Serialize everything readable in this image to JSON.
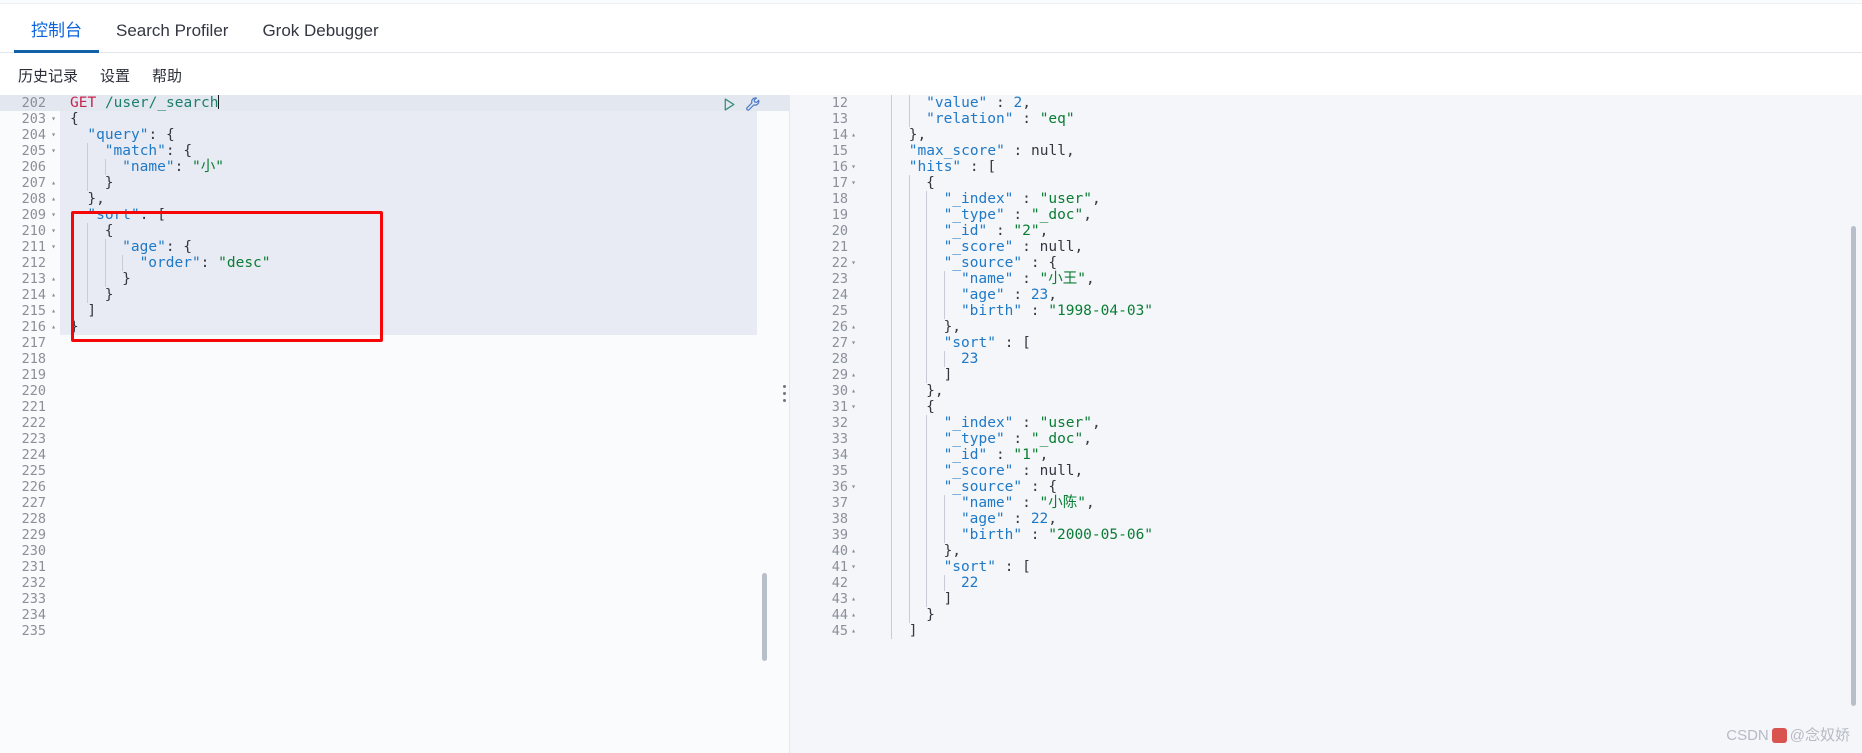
{
  "topbar": {
    "tabs": [
      {
        "label": "控制台",
        "active": true
      },
      {
        "label": "Search Profiler",
        "active": false
      },
      {
        "label": "Grok Debugger",
        "active": false
      }
    ]
  },
  "submenu": {
    "items": [
      {
        "label": "历史记录"
      },
      {
        "label": "设置"
      },
      {
        "label": "帮助"
      }
    ]
  },
  "colors": {
    "accent": "#0b64dd",
    "tab_underline": "#1361a8",
    "annotation_rect": "#f60606",
    "string": "#0a7d34",
    "key": "#2079c6",
    "method": "#c7254e",
    "url": "#1a7f6d",
    "active_line_bg": "#dfe3ed",
    "request_band_bg": "#e8ebf3"
  },
  "request_editor": {
    "name": "console-request-editor",
    "first_visible_line": 202,
    "active_line": 202,
    "icons": [
      {
        "name": "play-icon",
        "title": "click to send request"
      },
      {
        "name": "wrench-icon",
        "title": "open documentation"
      }
    ],
    "lines": [
      {
        "n": 202,
        "text": "GET /user/_search",
        "fold": "",
        "active": true
      },
      {
        "n": 203,
        "text": "{",
        "fold": "down"
      },
      {
        "n": 204,
        "text": "  \"query\": {",
        "fold": "down"
      },
      {
        "n": 205,
        "text": "    \"match\": {",
        "fold": "down"
      },
      {
        "n": 206,
        "text": "      \"name\": \"小\"",
        "fold": ""
      },
      {
        "n": 207,
        "text": "    }",
        "fold": "up"
      },
      {
        "n": 208,
        "text": "  },",
        "fold": "up"
      },
      {
        "n": 209,
        "text": "  \"sort\": [",
        "fold": "down"
      },
      {
        "n": 210,
        "text": "    {",
        "fold": "down"
      },
      {
        "n": 211,
        "text": "      \"age\": {",
        "fold": "down"
      },
      {
        "n": 212,
        "text": "        \"order\": \"desc\"",
        "fold": ""
      },
      {
        "n": 213,
        "text": "      }",
        "fold": "up"
      },
      {
        "n": 214,
        "text": "    }",
        "fold": "up"
      },
      {
        "n": 215,
        "text": "  ]",
        "fold": "up"
      },
      {
        "n": 216,
        "text": "}",
        "fold": "up"
      },
      {
        "n": 217,
        "text": "",
        "fold": ""
      },
      {
        "n": 218,
        "text": "",
        "fold": ""
      },
      {
        "n": 219,
        "text": "",
        "fold": ""
      },
      {
        "n": 220,
        "text": "",
        "fold": ""
      },
      {
        "n": 221,
        "text": "",
        "fold": ""
      },
      {
        "n": 222,
        "text": "",
        "fold": ""
      },
      {
        "n": 223,
        "text": "",
        "fold": ""
      },
      {
        "n": 224,
        "text": "",
        "fold": ""
      },
      {
        "n": 225,
        "text": "",
        "fold": ""
      },
      {
        "n": 226,
        "text": "",
        "fold": ""
      },
      {
        "n": 227,
        "text": "",
        "fold": ""
      },
      {
        "n": 228,
        "text": "",
        "fold": ""
      },
      {
        "n": 229,
        "text": "",
        "fold": ""
      },
      {
        "n": 230,
        "text": "",
        "fold": ""
      },
      {
        "n": 231,
        "text": "",
        "fold": ""
      },
      {
        "n": 232,
        "text": "",
        "fold": ""
      },
      {
        "n": 233,
        "text": "",
        "fold": ""
      },
      {
        "n": 234,
        "text": "",
        "fold": ""
      },
      {
        "n": 235,
        "text": "",
        "fold": ""
      }
    ],
    "annotation": {
      "name": "red-highlight-rectangle",
      "covers_lines": "209-216",
      "color": "#f60606"
    }
  },
  "response_editor": {
    "name": "console-response-editor",
    "first_visible_line": 12,
    "lines": [
      {
        "n": 12,
        "text": "      \"value\" : 2,",
        "fold": "",
        "clipped_top": true
      },
      {
        "n": 13,
        "text": "      \"relation\" : \"eq\"",
        "fold": ""
      },
      {
        "n": 14,
        "text": "    },",
        "fold": "up"
      },
      {
        "n": 15,
        "text": "    \"max_score\" : null,",
        "fold": ""
      },
      {
        "n": 16,
        "text": "    \"hits\" : [",
        "fold": "down"
      },
      {
        "n": 17,
        "text": "      {",
        "fold": "down"
      },
      {
        "n": 18,
        "text": "        \"_index\" : \"user\",",
        "fold": ""
      },
      {
        "n": 19,
        "text": "        \"_type\" : \"_doc\",",
        "fold": ""
      },
      {
        "n": 20,
        "text": "        \"_id\" : \"2\",",
        "fold": ""
      },
      {
        "n": 21,
        "text": "        \"_score\" : null,",
        "fold": ""
      },
      {
        "n": 22,
        "text": "        \"_source\" : {",
        "fold": "down"
      },
      {
        "n": 23,
        "text": "          \"name\" : \"小王\",",
        "fold": ""
      },
      {
        "n": 24,
        "text": "          \"age\" : 23,",
        "fold": ""
      },
      {
        "n": 25,
        "text": "          \"birth\" : \"1998-04-03\"",
        "fold": ""
      },
      {
        "n": 26,
        "text": "        },",
        "fold": "up"
      },
      {
        "n": 27,
        "text": "        \"sort\" : [",
        "fold": "down"
      },
      {
        "n": 28,
        "text": "          23",
        "fold": ""
      },
      {
        "n": 29,
        "text": "        ]",
        "fold": "up"
      },
      {
        "n": 30,
        "text": "      },",
        "fold": "up"
      },
      {
        "n": 31,
        "text": "      {",
        "fold": "down"
      },
      {
        "n": 32,
        "text": "        \"_index\" : \"user\",",
        "fold": ""
      },
      {
        "n": 33,
        "text": "        \"_type\" : \"_doc\",",
        "fold": ""
      },
      {
        "n": 34,
        "text": "        \"_id\" : \"1\",",
        "fold": ""
      },
      {
        "n": 35,
        "text": "        \"_score\" : null,",
        "fold": ""
      },
      {
        "n": 36,
        "text": "        \"_source\" : {",
        "fold": "down"
      },
      {
        "n": 37,
        "text": "          \"name\" : \"小陈\",",
        "fold": ""
      },
      {
        "n": 38,
        "text": "          \"age\" : 22,",
        "fold": ""
      },
      {
        "n": 39,
        "text": "          \"birth\" : \"2000-05-06\"",
        "fold": ""
      },
      {
        "n": 40,
        "text": "        },",
        "fold": "up"
      },
      {
        "n": 41,
        "text": "        \"sort\" : [",
        "fold": "down"
      },
      {
        "n": 42,
        "text": "          22",
        "fold": ""
      },
      {
        "n": 43,
        "text": "        ]",
        "fold": "up"
      },
      {
        "n": 44,
        "text": "      }",
        "fold": "up"
      },
      {
        "n": 45,
        "text": "    ]",
        "fold": "up"
      }
    ]
  },
  "watermark": {
    "text_left": "CSDN",
    "text_right": "@念奴娇"
  }
}
